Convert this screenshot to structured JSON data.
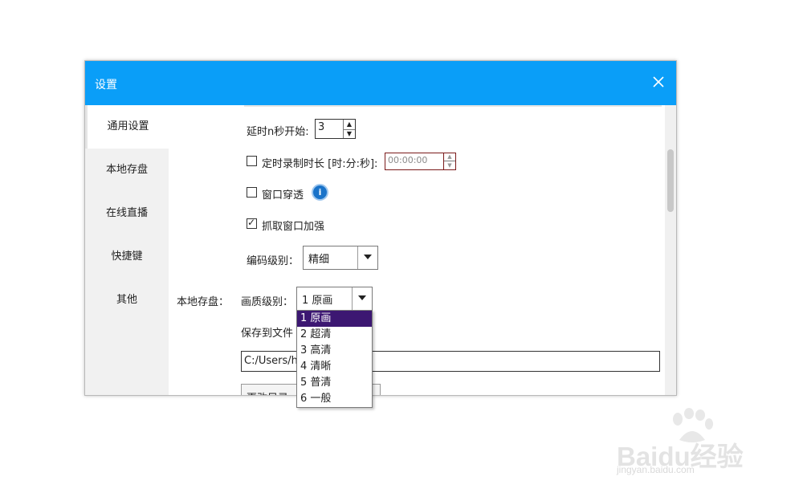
{
  "window": {
    "title": "设置"
  },
  "sidebar": {
    "items": [
      {
        "label": "通用设置",
        "active": true
      },
      {
        "label": "本地存盘"
      },
      {
        "label": "在线直播"
      },
      {
        "label": "快捷键"
      },
      {
        "label": "其他"
      }
    ]
  },
  "settings": {
    "delay_label": "延时n秒开始:",
    "delay_value": "3",
    "timer_label": "定时录制时长 [时:分:秒]:",
    "timer_value": "00:00:00",
    "window_through_label": "窗口穿透",
    "window_capture_label": "抓取窗口加强",
    "encode_label": "编码级别：",
    "encode_value": "精细",
    "section_local": "本地存盘：",
    "quality_label": "画质级别：",
    "quality_value": "1 原画",
    "save_label": "保存到文件",
    "save_path": "C:/Users/h",
    "change_dir_label": "更改目录"
  },
  "quality_options": [
    "1 原画",
    "2 超清",
    "3 高清",
    "4 清晰",
    "5 普清",
    "6 一般"
  ],
  "selected_quality_index": 0,
  "watermark": {
    "brand": "Baidu经验",
    "site": "jingyan.baidu.com"
  },
  "colors": {
    "titlebar": "#0a9ef8",
    "selection": "#3c1772"
  }
}
